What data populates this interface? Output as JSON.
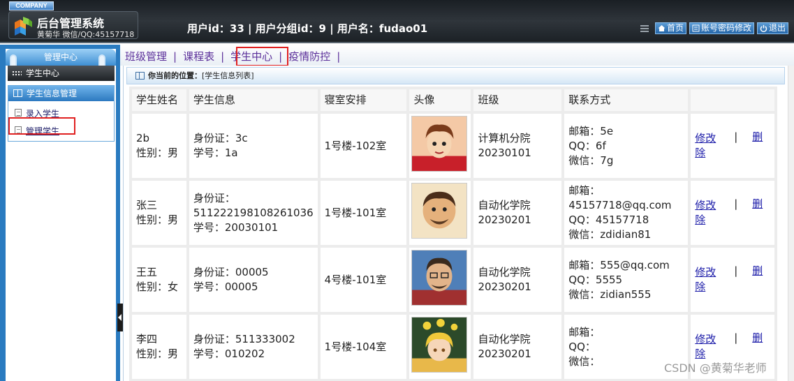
{
  "header": {
    "company": "COMPANY",
    "title": "后台管理系统",
    "subtitle": "黄菊华 微信/QQ:45157718",
    "user_line": "用户id：33 | 用户分组id：9 | 用户名：fudao01",
    "actions": [
      {
        "label": "首页",
        "icon": "home-icon"
      },
      {
        "label": "账号密码修改",
        "icon": "account-icon"
      },
      {
        "label": "退出",
        "icon": "power-icon"
      }
    ]
  },
  "sidebar": {
    "title": "管理中心",
    "center_item": "学生中心",
    "group_title": "学生信息管理",
    "links": [
      "录入学生",
      "管理学生"
    ]
  },
  "nav": {
    "items": [
      "班级管理",
      "课程表",
      "学生中心",
      "疫情防控"
    ],
    "sep": "|"
  },
  "position": {
    "label": "你当前的位置：",
    "value": "[学生信息列表]"
  },
  "table": {
    "headers": [
      "学生姓名",
      "学生信息",
      "寝室安排",
      "头像",
      "班级",
      "联系方式",
      ""
    ],
    "rows": [
      {
        "name": "2b",
        "gender": "性别：男",
        "info": [
          "身份证：3c",
          "学号：1a"
        ],
        "dorm": "1号楼-102室",
        "avatar": "avatar-red-shirt",
        "college": "计算机分院",
        "class": "20230101",
        "contact": [
          "邮箱：5e",
          "QQ：6f",
          "微信：7g"
        ]
      },
      {
        "name": "张三",
        "gender": "性别：男",
        "info": [
          "身份证：",
          "511222198108261036",
          "学号：20030101"
        ],
        "dorm": "1号楼-101室",
        "avatar": "avatar-beard",
        "college": "自动化学院",
        "class": "20230201",
        "contact": [
          "邮箱：",
          "45157718@qq.com",
          "QQ：45157718",
          "微信：zdidian81"
        ]
      },
      {
        "name": "王五",
        "gender": "性别：女",
        "info": [
          "身份证：00005",
          "学号：00005"
        ],
        "dorm": "4号楼-101室",
        "avatar": "avatar-glasses",
        "college": "自动化学院",
        "class": "20230201",
        "contact": [
          "邮箱：555@qq.com",
          "QQ：5555",
          "微信：zidian555"
        ]
      },
      {
        "name": "李四",
        "gender": "性别：男",
        "info": [
          "身份证：511333002",
          "学号：010202"
        ],
        "dorm": "1号楼-104室",
        "avatar": "avatar-anime",
        "college": "自动化学院",
        "class": "20230201",
        "contact": [
          "邮箱：",
          "QQ：",
          "微信："
        ]
      }
    ],
    "edit_label_1": "修改",
    "edit_label_2": "除",
    "sep": "|",
    "delete_label": "删"
  },
  "watermark": "CSDN @黄菊华老师",
  "colors": {
    "accent_blue": "#2a7bc0",
    "nav_purple": "#5b2f9a",
    "highlight_red": "#e02020",
    "link_blue": "#1a1aa8"
  }
}
